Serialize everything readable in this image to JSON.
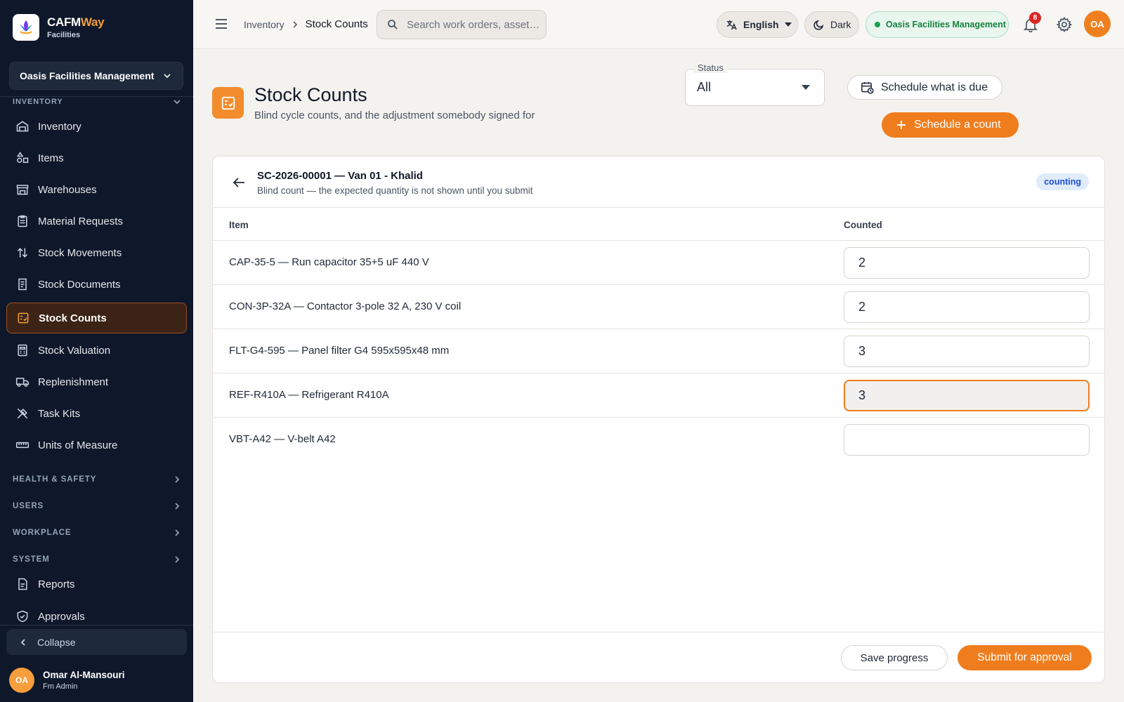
{
  "brand": {
    "name_main": "CAFM",
    "name_accent": "Way",
    "subtitle": "Facilities"
  },
  "org_selector": {
    "label": "Oasis Facilities Management"
  },
  "sidebar": {
    "section_inventory": "INVENTORY",
    "items": [
      {
        "label": "Inventory",
        "icon": "warehouse-icon"
      },
      {
        "label": "Items",
        "icon": "shapes-icon"
      },
      {
        "label": "Warehouses",
        "icon": "store-icon"
      },
      {
        "label": "Material Requests",
        "icon": "clipboard-icon"
      },
      {
        "label": "Stock Movements",
        "icon": "swap-vertical-icon"
      },
      {
        "label": "Stock Documents",
        "icon": "receipt-icon"
      },
      {
        "label": "Stock Counts",
        "icon": "checklist-icon",
        "active": true
      },
      {
        "label": "Stock Valuation",
        "icon": "calculator-icon"
      },
      {
        "label": "Replenishment",
        "icon": "truck-icon"
      },
      {
        "label": "Task Kits",
        "icon": "tools-icon"
      },
      {
        "label": "Units of Measure",
        "icon": "ruler-icon"
      }
    ],
    "sections": [
      "HEALTH & SAFETY",
      "USERS",
      "WORKPLACE",
      "SYSTEM"
    ],
    "bottom_items": [
      {
        "label": "Reports",
        "icon": "report-icon"
      },
      {
        "label": "Approvals",
        "icon": "shield-check-icon"
      }
    ],
    "collapse_label": "Collapse"
  },
  "user": {
    "initials": "OA",
    "name": "Omar Al-Mansouri",
    "role": "Fm Admin"
  },
  "topbar": {
    "breadcrumb": [
      "Inventory",
      "Stock Counts"
    ],
    "search_placeholder": "Search work orders, asset…",
    "language": "English",
    "theme": "Dark",
    "org_badge": "Oasis Facilities Management",
    "notification_count": "8",
    "avatar_initials": "OA"
  },
  "page": {
    "title": "Stock Counts",
    "subtitle": "Blind cycle counts, and the adjustment somebody signed for",
    "status_filter": {
      "label": "Status",
      "value": "All"
    },
    "schedule_due_label": "Schedule what is due",
    "schedule_count_label": "Schedule a count"
  },
  "count": {
    "title": "SC-2026-00001 — Van 01 - Khalid",
    "subtitle": "Blind count — the expected quantity is not shown until you submit",
    "status": "counting",
    "columns": {
      "item": "Item",
      "counted": "Counted"
    },
    "rows": [
      {
        "item": "CAP-35-5 — Run capacitor 35+5 uF 440 V",
        "counted": "2"
      },
      {
        "item": "CON-3P-32A — Contactor 3-pole 32 A, 230 V coil",
        "counted": "2"
      },
      {
        "item": "FLT-G4-595 — Panel filter G4 595x595x48 mm",
        "counted": "3"
      },
      {
        "item": "REF-R410A — Refrigerant R410A",
        "counted": "3"
      },
      {
        "item": "VBT-A42 — V-belt A42",
        "counted": ""
      }
    ],
    "save_label": "Save progress",
    "submit_label": "Submit for approval"
  },
  "colors": {
    "accent": "#ef7d1d",
    "sidebar_bg": "#0f172a",
    "badge_blue": "#1d4ed8",
    "org_green": "#15803d"
  }
}
